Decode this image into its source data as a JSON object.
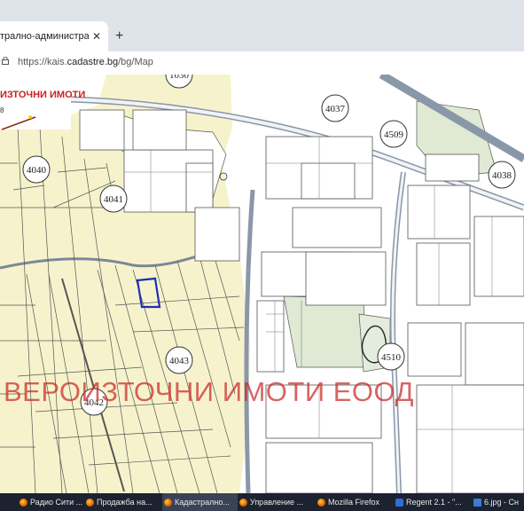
{
  "browser": {
    "tab_title": "трално-административ",
    "tab_close": "✕",
    "new_tab": "+",
    "url_prefix": "https://kais.",
    "url_domain": "cadastre.bg",
    "url_path": "/bg/Map"
  },
  "map": {
    "logo_text": "ИЗТОЧНИ ИМОТИ",
    "logo_sub": "8",
    "watermark": "ВЕРОИЗТОЧНИ ИМОТИ ЕООД",
    "plot_numbers": [
      "1030",
      "4037",
      "4509",
      "4040",
      "4041",
      "4038",
      "4043",
      "4042",
      "4510"
    ]
  },
  "taskbar": {
    "items": [
      {
        "label": "Радио Сити ..."
      },
      {
        "label": "Продажба на..."
      },
      {
        "label": "Кадастрално..."
      },
      {
        "label": "Управление ..."
      },
      {
        "label": "Mozilla Firefox"
      },
      {
        "label": "Regent 2.1 - \"..."
      },
      {
        "label": "6.jpg - Сн"
      }
    ]
  },
  "colors": {
    "parcel_yellow": "#f6f3cc",
    "green_zone": "#dfe9d3",
    "road_line": "#7a8898",
    "highlight_parcel": "#1b2fb5",
    "watermark": "#c82828"
  }
}
